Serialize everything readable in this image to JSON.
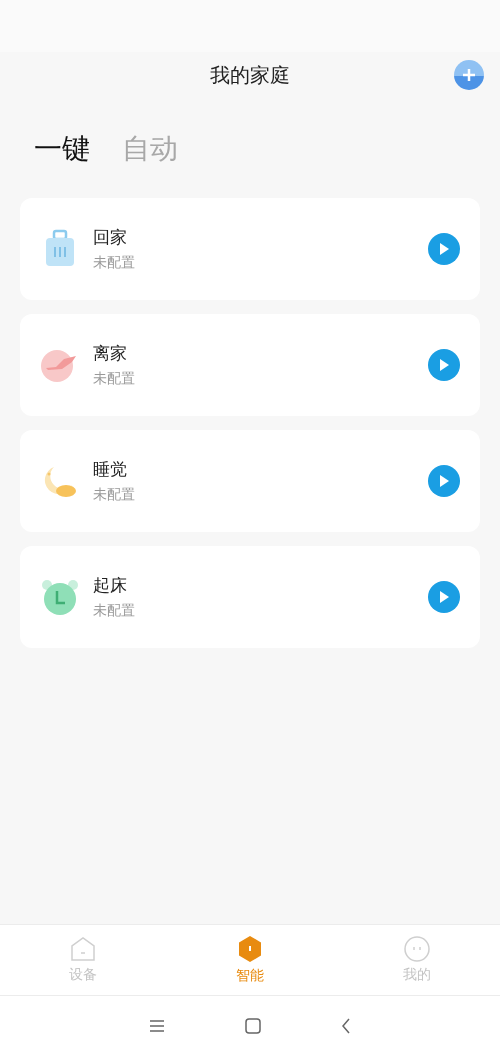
{
  "header": {
    "title": "我的家庭"
  },
  "tabs": [
    {
      "label": "一键",
      "selected": true
    },
    {
      "label": "自动",
      "selected": false
    }
  ],
  "scenes": [
    {
      "name": "回家",
      "status": "未配置"
    },
    {
      "name": "离家",
      "status": "未配置"
    },
    {
      "name": "睡觉",
      "status": "未配置"
    },
    {
      "name": "起床",
      "status": "未配置"
    }
  ],
  "bottom_nav": [
    {
      "label": "设备",
      "selected": false
    },
    {
      "label": "智能",
      "selected": true
    },
    {
      "label": "我的",
      "selected": false
    }
  ]
}
